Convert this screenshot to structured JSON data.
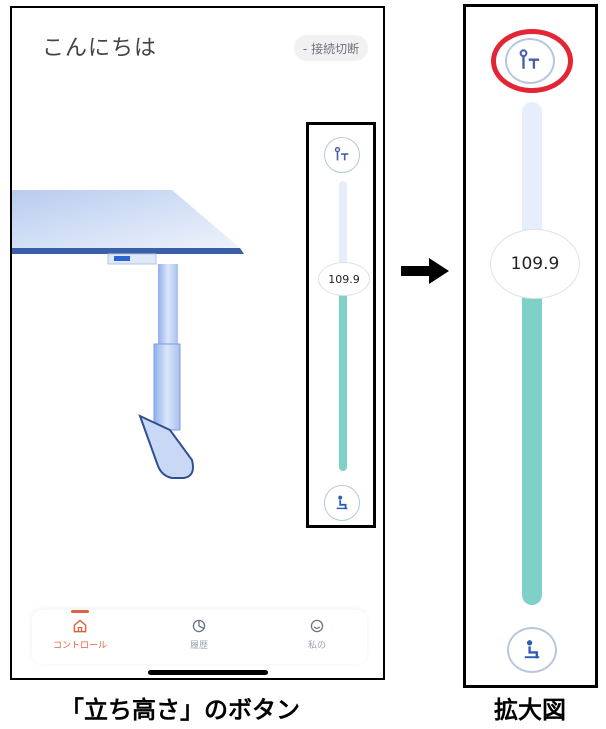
{
  "app": {
    "greeting": "こんにちは",
    "disconnect_label": "- 接続切断"
  },
  "slider": {
    "height_value": "109.9"
  },
  "nav": {
    "items": [
      {
        "label": "コントロール",
        "icon": "home-icon",
        "active": true
      },
      {
        "label": "履歴",
        "icon": "chart-icon",
        "active": false
      },
      {
        "label": "私の",
        "icon": "smile-icon",
        "active": false
      }
    ]
  },
  "captions": {
    "left": "「立ち高さ」のボタン",
    "right": "拡大図"
  },
  "colors": {
    "accent": "#e0643b",
    "track_fill": "#7fd1c7",
    "track_empty": "#e6eefb",
    "highlight_ring": "#e32636",
    "desk_blue": "#5f86d6"
  }
}
